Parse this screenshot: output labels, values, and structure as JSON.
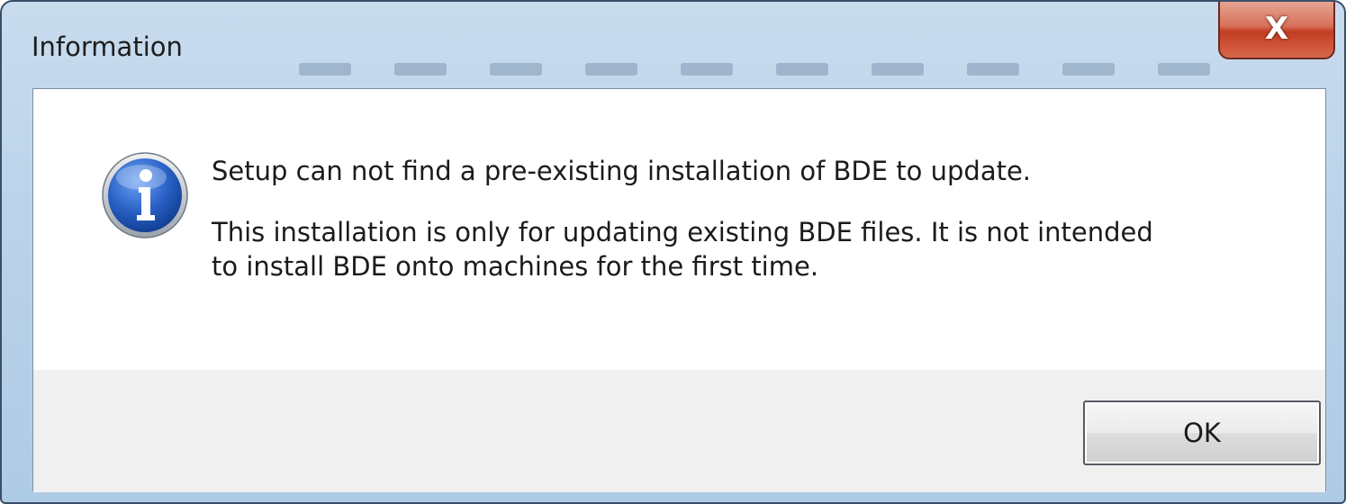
{
  "window": {
    "title": "Information",
    "close_label": "X"
  },
  "message": {
    "icon": "information-icon",
    "line1": "Setup can not find a pre-existing installation of BDE to update.",
    "line2a": "This installation is only for updating existing BDE files. It is not intended",
    "line2b": "to install BDE onto machines for the first time."
  },
  "buttons": {
    "ok_label": "OK"
  },
  "colors": {
    "icon_blue": "#1f56b5",
    "close_red": "#c23d22"
  }
}
